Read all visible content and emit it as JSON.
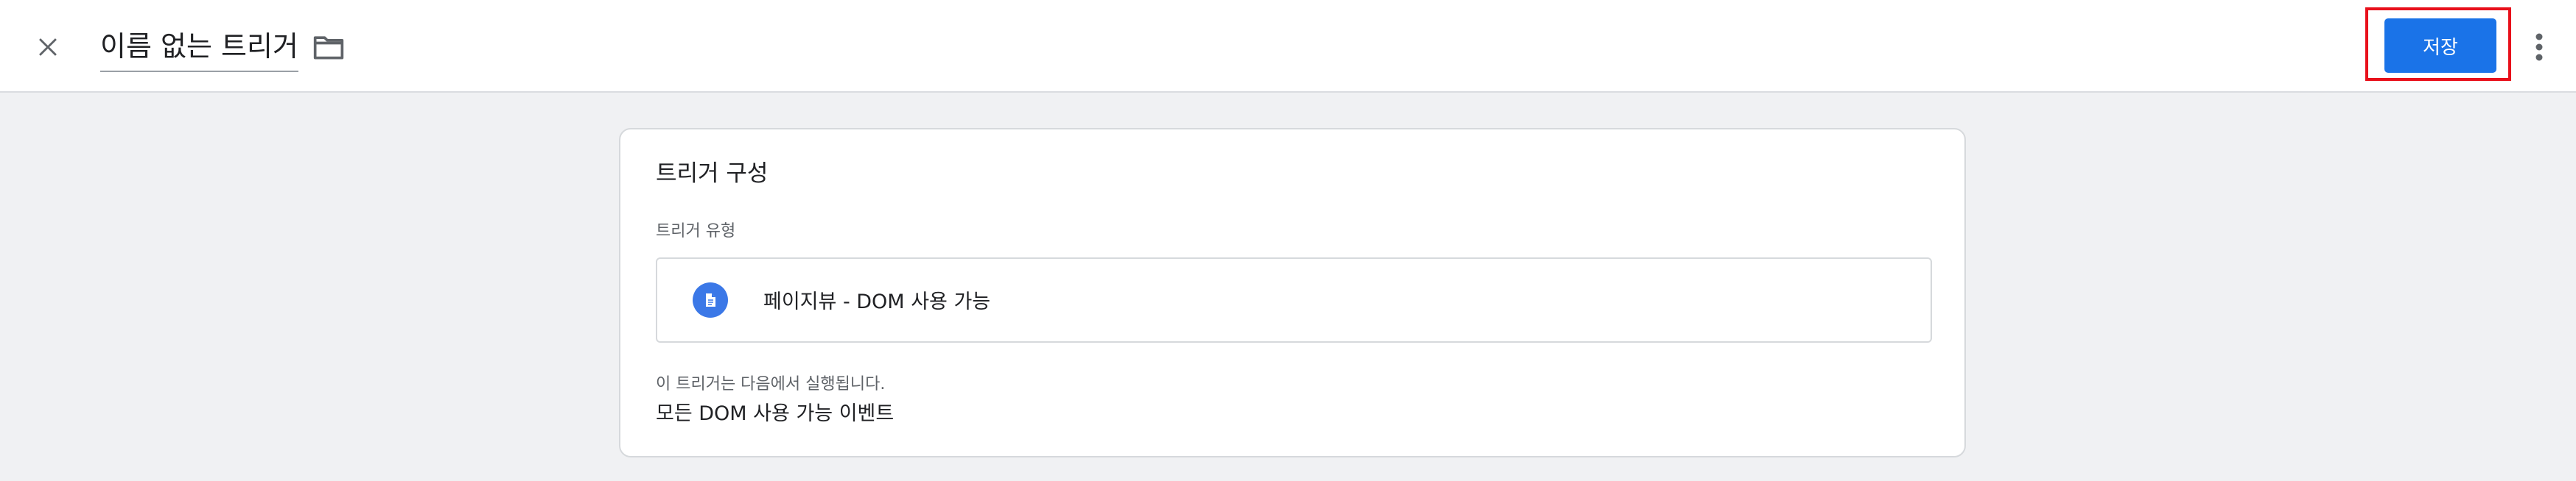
{
  "header": {
    "title": "이름 없는 트리거",
    "save_label": "저장",
    "accent_color": "#1a73e8",
    "highlight_color": "#e8101b"
  },
  "icons": {
    "close": "close-icon",
    "folder": "folder-icon",
    "more": "more-vert-icon",
    "trigger_type": "document-icon"
  },
  "card": {
    "title": "트리거 구성",
    "trigger_type_label": "트리거 유형",
    "trigger_type_value": "페이지뷰 - DOM 사용 가능",
    "fires_on_label": "이 트리거는 다음에서 실행됩니다.",
    "fires_on_value": "모든 DOM 사용 가능 이벤트"
  }
}
